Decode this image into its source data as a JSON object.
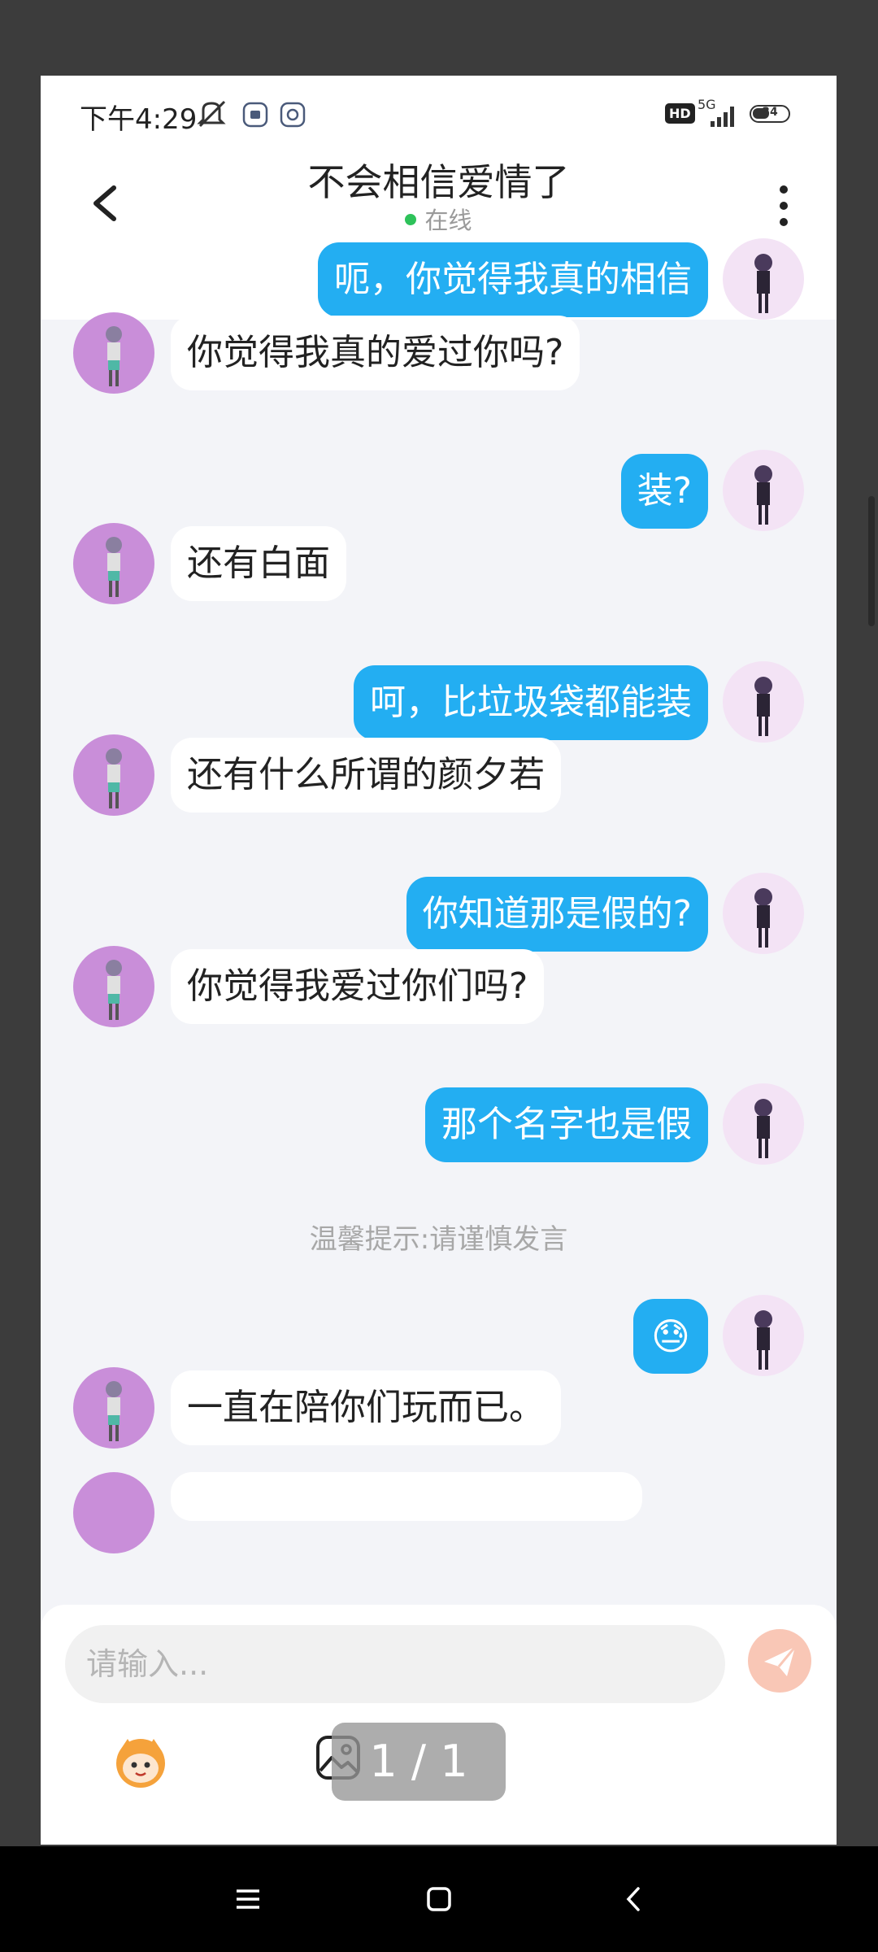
{
  "status_bar": {
    "time": "下午4:29",
    "network": "5G",
    "hd": "HD",
    "battery": "34"
  },
  "header": {
    "title": "不会相信爱情了",
    "status": "在线"
  },
  "messages": [
    {
      "side": "me",
      "text": "呃，你觉得我真的相信"
    },
    {
      "side": "other",
      "text": "你觉得我真的爱过你吗?"
    },
    {
      "side": "me",
      "text": "装?"
    },
    {
      "side": "other",
      "text": "还有白面"
    },
    {
      "side": "me",
      "text": "呵，比垃圾袋都能装"
    },
    {
      "side": "other",
      "text": "还有什么所谓的颜夕若"
    },
    {
      "side": "me",
      "text": "你知道那是假的?"
    },
    {
      "side": "other",
      "text": "你觉得我爱过你们吗?"
    },
    {
      "side": "me",
      "text": "那个名字也是假"
    },
    {
      "side": "me",
      "text": "😓"
    },
    {
      "side": "other",
      "text": "一直在陪你们玩而已。"
    }
  ],
  "system_tip": "温馨提示:请谨慎发言",
  "input": {
    "placeholder": "请输入..."
  },
  "page_indicator": "1 / 1"
}
